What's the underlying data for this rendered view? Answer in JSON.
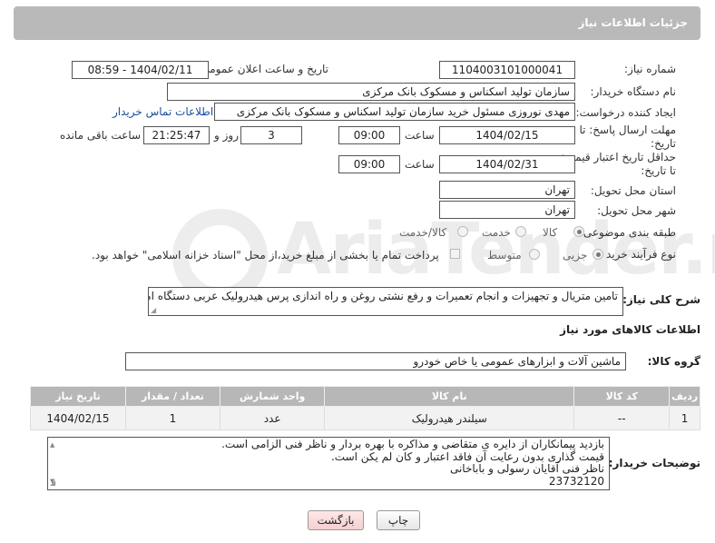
{
  "header": {
    "title": "جزئیات اطلاعات نیاز"
  },
  "fields": {
    "need_number_label": "شماره نیاز:",
    "need_number": "1104003101000041",
    "announce_label": "تاریخ و ساعت اعلان عمومی:",
    "announce_value": "1404/02/11 - 08:59",
    "buyer_org_label": "نام دستگاه خریدار:",
    "buyer_org": "سازمان تولید اسکناس و مسکوک بانک مرکزی",
    "requester_label": "ایجاد کننده درخواست:",
    "requester": "مهدی نوروزی مسئول خرید سازمان تولید اسکناس و مسکوک بانک مرکزی",
    "contact_link": "اطلاعات تماس خریدار",
    "deadline_label": "مهلت ارسال پاسخ: تا تاریخ:",
    "deadline_date": "1404/02/15",
    "time_label": "ساعت",
    "deadline_time": "09:00",
    "days_value": "3",
    "days_label": "روز و",
    "remaining_time": "21:25:47",
    "remaining_label": "ساعت باقی مانده",
    "validity_label": "حداقل تاریخ اعتبار قیمت: تا تاریخ:",
    "validity_date": "1404/02/31",
    "validity_time": "09:00",
    "province_label": "استان محل تحویل:",
    "province": "تهران",
    "city_label": "شهر محل تحویل:",
    "city": "تهران",
    "category_label": "طبقه بندی موضوعی:",
    "category_options": [
      "کالا",
      "خدمت",
      "کالا/خدمت"
    ],
    "process_label": "نوع فرآیند خرید :",
    "process_options": [
      "جزیی",
      "متوسط"
    ],
    "payment_note": "پرداخت تمام یا بخشی از مبلغ خرید،از محل \"اسناد خزانه اسلامی\" خواهد بود.",
    "description_label": "شرح کلی نیاز:",
    "description": "تامین متریال و تجهیزات و انجام تعمیرات و رفع نشتی روغن و راه اندازی پرس هیدرولیک عربی دستگاه امحاء"
  },
  "goods_section": {
    "title": "اطلاعات کالاهای مورد نیاز",
    "group_label": "گروه کالا:",
    "group_value": "ماشین آلات و ابزارهای عمومی یا خاص خودرو"
  },
  "table": {
    "headers": [
      "ردیف",
      "کد کالا",
      "نام کالا",
      "واحد شمارش",
      "تعداد / مقدار",
      "تاریخ نیاز"
    ],
    "rows": [
      [
        "1",
        "--",
        "سیلندر هیدرولیک",
        "عدد",
        "1",
        "1404/02/15"
      ]
    ]
  },
  "notes": {
    "label": "توضیحات خریدار:",
    "lines": [
      "بازدید پیمانکاران از دایره ی متقاضی و مذاکره با بهره بردار و ناظر فنی الزامی است.",
      "قیمت گذاری بدون رعایت آن فاقد اعتبار و کان لم یکن است.",
      "ناظر فنی آقایان رسولی و باباخانی",
      "23732120"
    ]
  },
  "buttons": {
    "print": "چاپ",
    "back": "بازگشت"
  },
  "watermark": {
    "text": "AriaTender.net"
  }
}
